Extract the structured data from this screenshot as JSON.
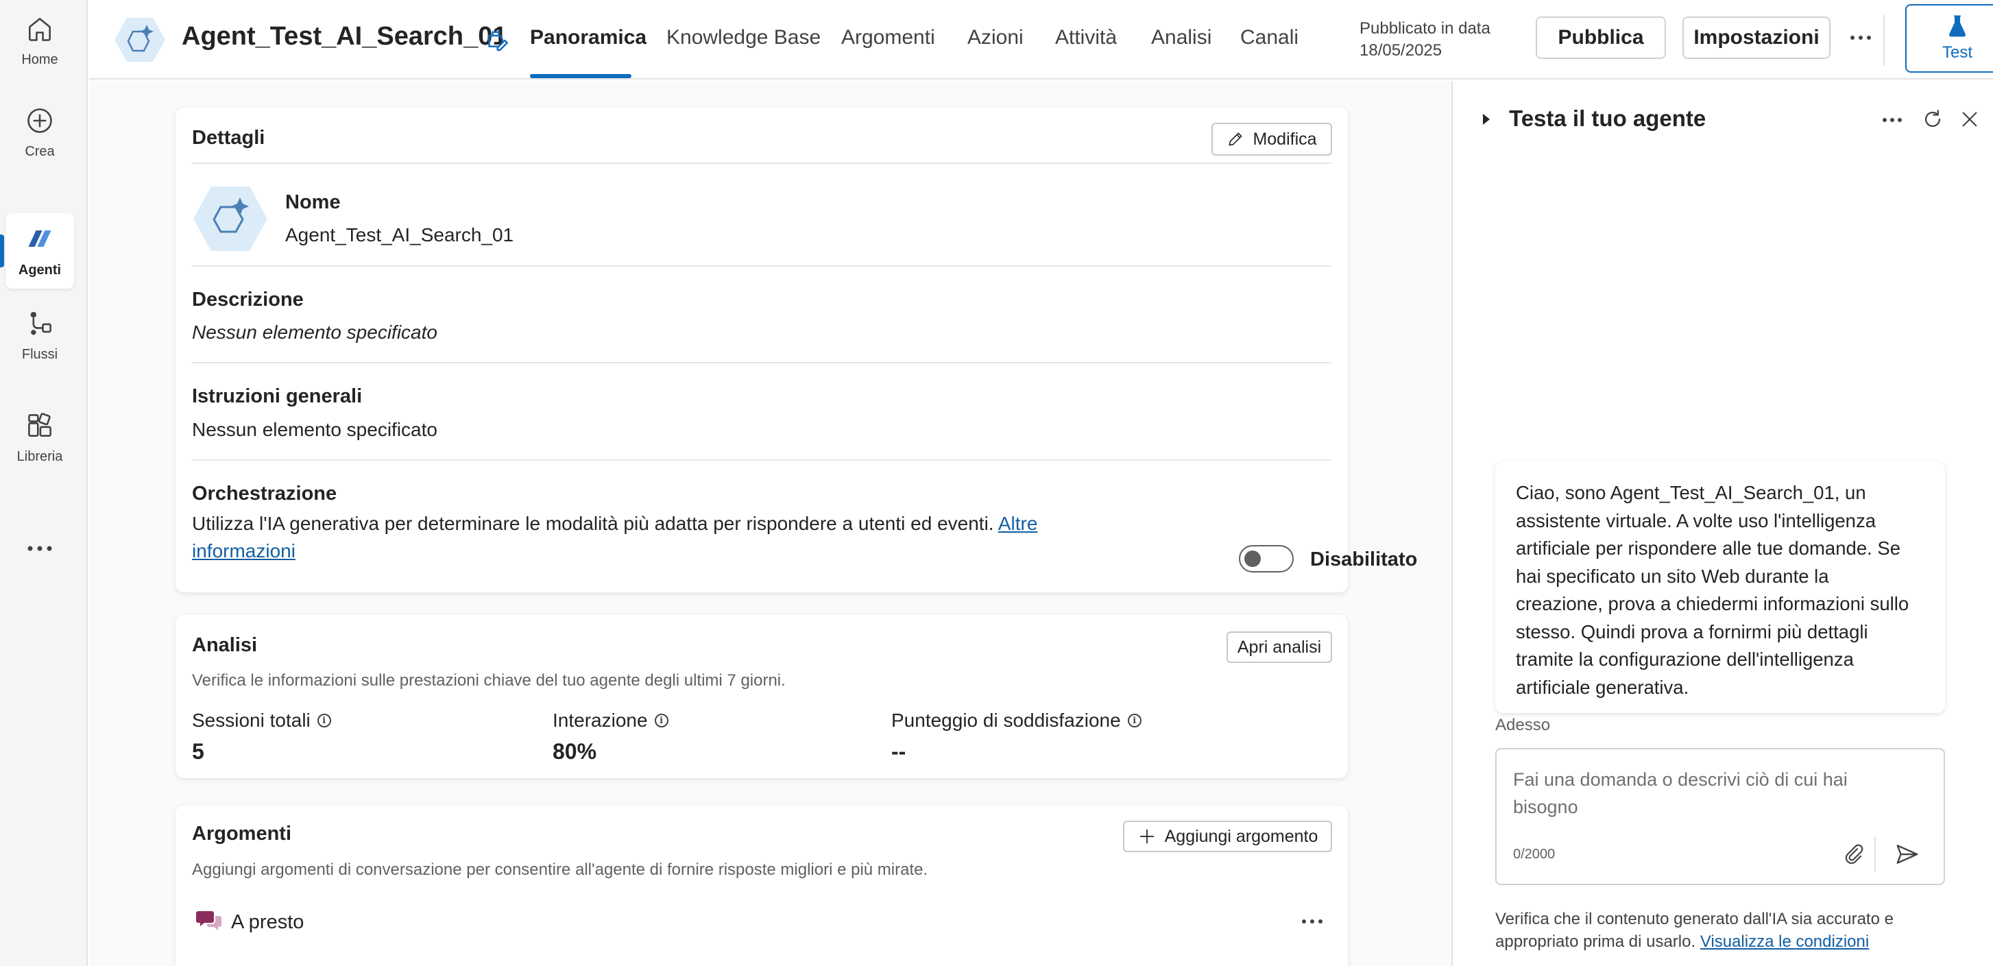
{
  "rail": {
    "items": [
      {
        "label": "Home",
        "icon": "home-icon"
      },
      {
        "label": "Crea",
        "icon": "plus-circle-icon"
      },
      {
        "label": "Agenti",
        "icon": "agents-icon"
      },
      {
        "label": "Flussi",
        "icon": "flow-icon"
      },
      {
        "label": "Libreria",
        "icon": "library-icon"
      }
    ],
    "active": "Agenti"
  },
  "header": {
    "agent_name": "Agent_Test_AI_Search_01",
    "tabs": [
      "Panoramica",
      "Knowledge Base",
      "Argomenti",
      "Azioni",
      "Attività",
      "Analisi",
      "Canali"
    ],
    "active_tab": "Panoramica",
    "published_label": "Pubblicato in data",
    "published_date": "18/05/2025",
    "publish_button": "Pubblica",
    "settings_button": "Impostazioni",
    "test_button": "Test"
  },
  "details": {
    "title": "Dettagli",
    "edit_button": "Modifica",
    "name_label": "Nome",
    "name_value": "Agent_Test_AI_Search_01",
    "description_label": "Descrizione",
    "description_value": "Nessun elemento specificato",
    "instructions_label": "Istruzioni generali",
    "instructions_value": "Nessun elemento specificato",
    "orchestration_label": "Orchestrazione",
    "orchestration_text": "Utilizza l'IA generativa per determinare le modalità più adatta per rispondere a utenti ed eventi.",
    "orchestration_link_1": "Altre",
    "orchestration_link_2": "informazioni",
    "orchestration_state": "Disabilitato"
  },
  "analytics": {
    "title": "Analisi",
    "open_button": "Apri analisi",
    "description": "Verifica le informazioni sulle prestazioni chiave del tuo agente degli ultimi 7 giorni.",
    "metrics": [
      {
        "label": "Sessioni totali",
        "value": "5"
      },
      {
        "label": "Interazione",
        "value": "80%"
      },
      {
        "label": "Punteggio di soddisfazione",
        "value": "--"
      }
    ]
  },
  "topics": {
    "title": "Argomenti",
    "add_button": "Aggiungi argomento",
    "description": "Aggiungi argomenti di conversazione per consentire all'agente di fornire risposte migliori e più mirate.",
    "items": [
      {
        "label": "A presto"
      }
    ]
  },
  "test_panel": {
    "title": "Testa il tuo agente",
    "message_lines": [
      "Ciao, sono Agent_Test_AI_Search_01, un",
      "assistente virtuale. A volte uso l'intelligenza",
      "artificiale per rispondere alle tue domande. Se",
      "hai specificato un sito Web durante la",
      "creazione, prova a chiedermi informazioni sullo",
      "stesso. Quindi prova a fornirmi più dettagli",
      "tramite la configurazione dell'intelligenza",
      "artificiale generativa."
    ],
    "timestamp": "Adesso",
    "input_placeholder": "Fai una domanda o descrivi ciò di cui hai bisogno",
    "char_counter": "0/2000",
    "disclaimer": "Verifica che il contenuto generato dall'IA sia accurato e appropriato prima di usarlo.",
    "terms_link": "Visualizza le condizioni"
  },
  "colors": {
    "accent": "#0f6cbd",
    "topic_icon": "#8b2c5d"
  }
}
